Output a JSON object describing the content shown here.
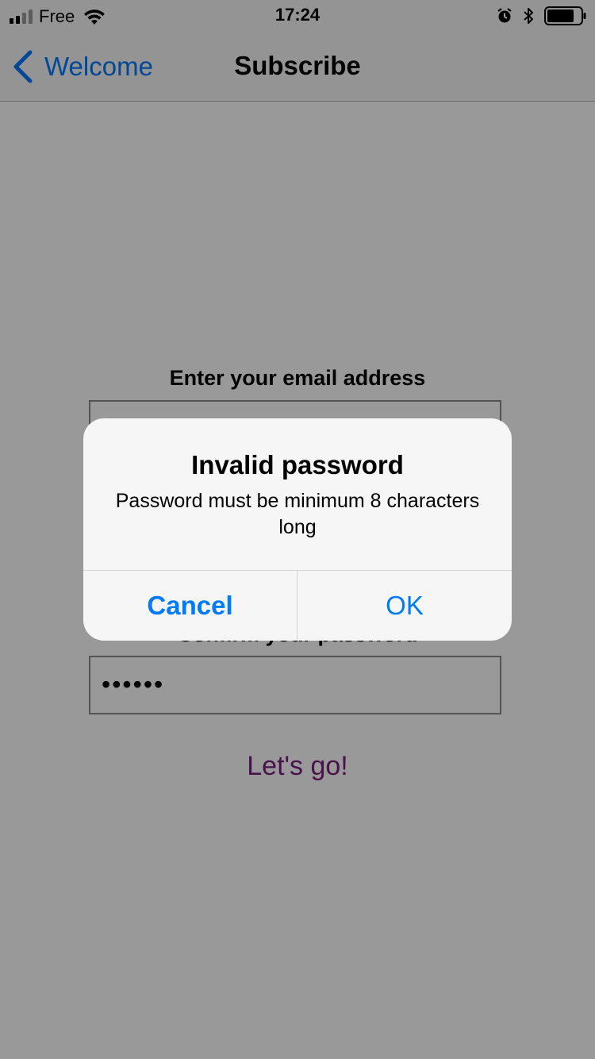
{
  "status_bar": {
    "carrier": "Free",
    "time": "17:24",
    "icons": [
      "signal-icon",
      "wifi-icon",
      "alarm-icon",
      "bluetooth-icon",
      "battery-icon"
    ]
  },
  "nav": {
    "back_label": "Welcome",
    "title": "Subscribe"
  },
  "form": {
    "email_label": "Enter your email address",
    "email_value": "",
    "confirm_label": "Confirm your password",
    "confirm_value": "••••••",
    "submit_label": "Let's go!"
  },
  "alert": {
    "title": "Invalid password",
    "message": "Password must be minimum 8 characters long",
    "cancel_label": "Cancel",
    "ok_label": "OK"
  },
  "colors": {
    "accent": "#007aff",
    "submit_text": "#7a1f7e"
  }
}
